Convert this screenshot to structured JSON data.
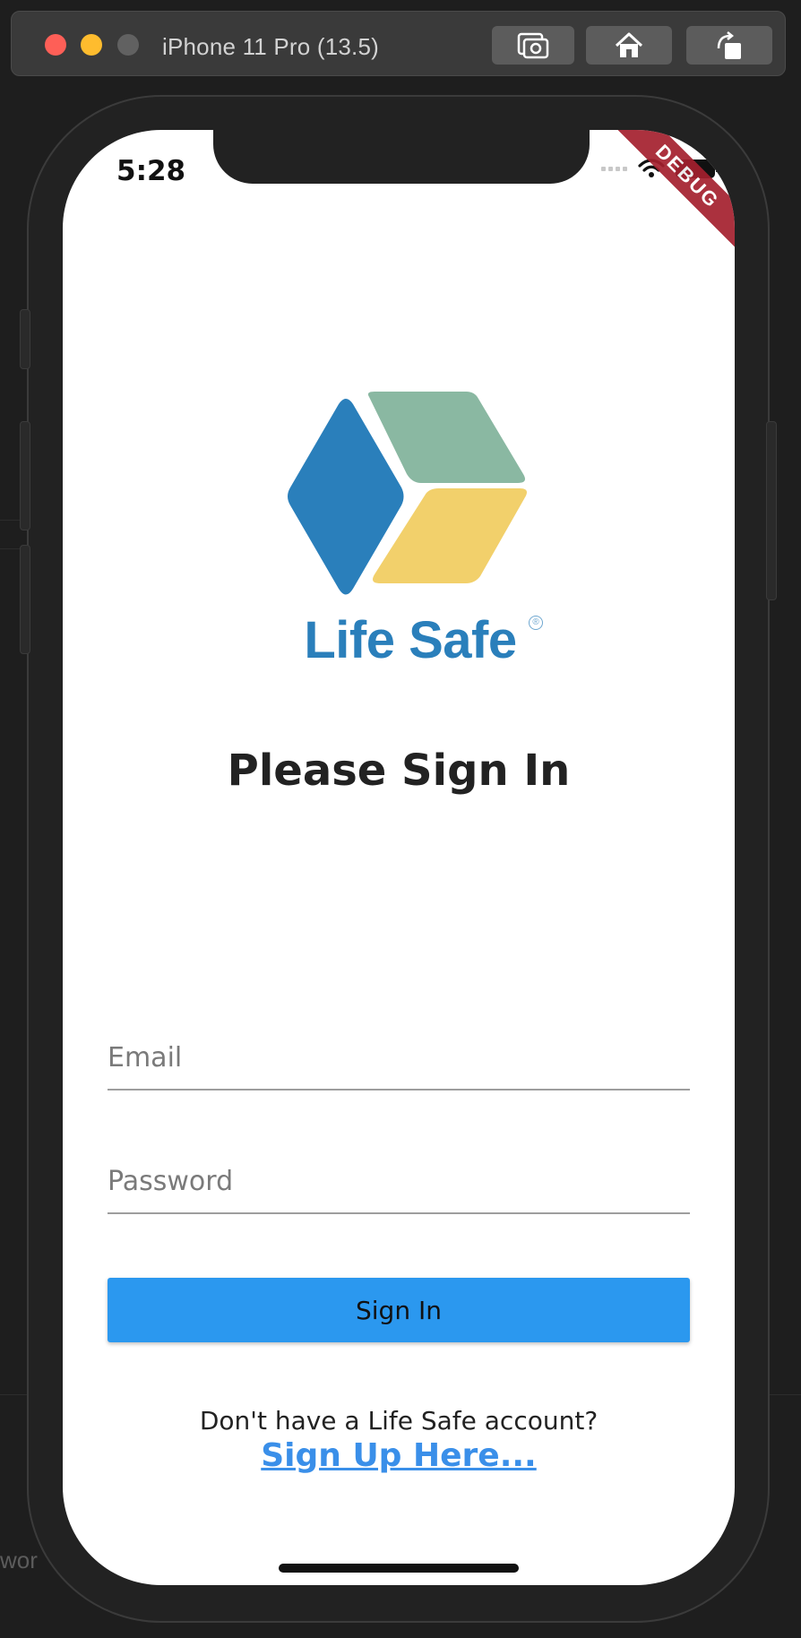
{
  "simulator": {
    "title": "iPhone 11 Pro (13.5)"
  },
  "background": {
    "partial_text": "wor"
  },
  "status_bar": {
    "time": "5:28"
  },
  "debug_banner": {
    "label": "DEBUG",
    "color": "#a4202e"
  },
  "logo": {
    "text": "Life Safe",
    "registered_mark": "®",
    "colors": {
      "blue": "#2a7fbb",
      "green": "#8ab8a2",
      "yellow": "#f2d06b"
    }
  },
  "login": {
    "title": "Please Sign In",
    "email_placeholder": "Email",
    "password_placeholder": "Password",
    "sign_in_label": "Sign In",
    "no_account_text": "Don't have a Life Safe account?",
    "sign_up_link": "Sign Up Here..."
  },
  "colors": {
    "primary_button": "#2b98ef",
    "link": "#3a8fe9"
  }
}
